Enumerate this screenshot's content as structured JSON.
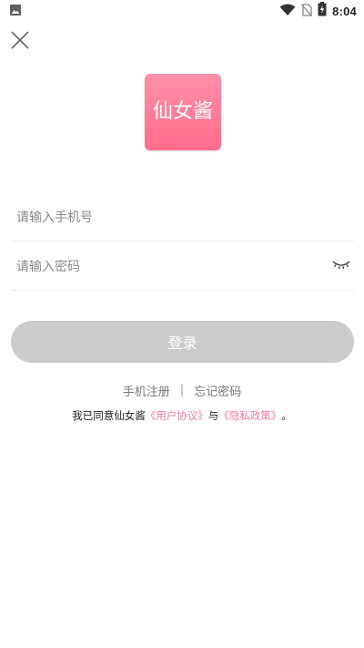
{
  "status_bar": {
    "time": "8:04",
    "icons": [
      "image-notification-icon",
      "wifi-icon",
      "no-sim-icon",
      "battery-charging-icon"
    ]
  },
  "header": {
    "close_icon": "close-icon"
  },
  "logo": {
    "text": "仙女酱",
    "color_top": "#ff8fa8",
    "color_bottom": "#ff6d8b"
  },
  "form": {
    "phone_placeholder": "请输入手机号",
    "phone_value": "",
    "password_placeholder": "请输入密码",
    "password_value": "",
    "password_toggle_icon": "eye-closed-icon",
    "login_label": "登录",
    "login_button_color": "#cccccc"
  },
  "links": {
    "register": "手机注册",
    "separator": "|",
    "forgot_password": "忘记密码"
  },
  "agreement": {
    "prefix": "我已同意仙女酱",
    "user_agreement": "《用户协议》",
    "connector": "与",
    "privacy_policy": "《隐私政策》",
    "suffix": "。",
    "link_color": "#ef7ea0"
  }
}
